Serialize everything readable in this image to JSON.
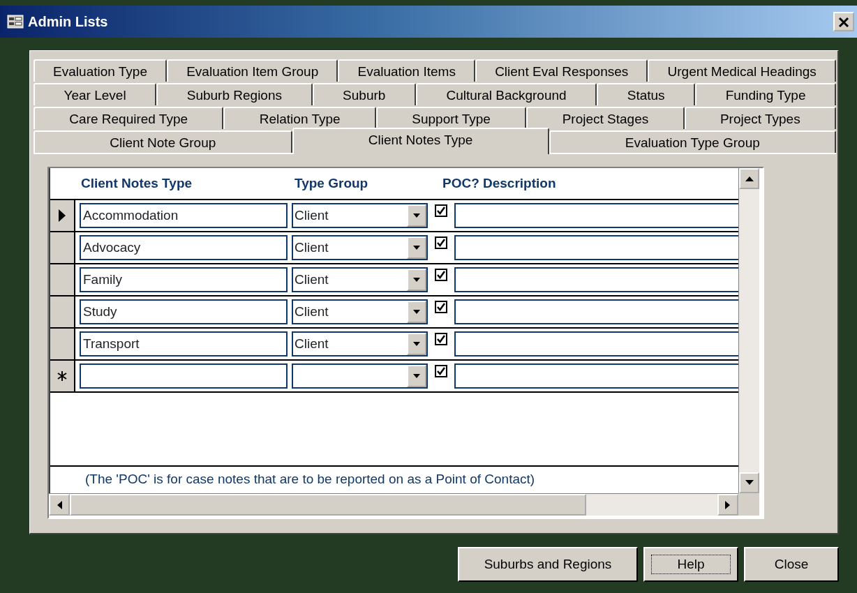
{
  "window": {
    "title": "Admin Lists"
  },
  "tab_rows": [
    [
      {
        "label": "Evaluation Type",
        "selected": false
      },
      {
        "label": "Evaluation Item Group",
        "selected": false
      },
      {
        "label": "Evaluation Items",
        "selected": false
      },
      {
        "label": "Client Eval Responses",
        "selected": false
      },
      {
        "label": "Urgent Medical Headings",
        "selected": false
      }
    ],
    [
      {
        "label": "Year Level",
        "selected": false
      },
      {
        "label": "Suburb Regions",
        "selected": false
      },
      {
        "label": "Suburb",
        "selected": false
      },
      {
        "label": "Cultural Background",
        "selected": false
      },
      {
        "label": "Status",
        "selected": false
      },
      {
        "label": "Funding Type",
        "selected": false
      }
    ],
    [
      {
        "label": "Care Required Type",
        "selected": false
      },
      {
        "label": "Relation Type",
        "selected": false
      },
      {
        "label": "Support Type",
        "selected": false
      },
      {
        "label": "Project Stages",
        "selected": false
      },
      {
        "label": "Project Types",
        "selected": false
      }
    ],
    [
      {
        "label": "Client Note Group",
        "selected": false
      },
      {
        "label": "Client Notes Type",
        "selected": true
      },
      {
        "label": "Evaluation Type Group",
        "selected": false
      }
    ]
  ],
  "grid": {
    "columns": [
      "Client Notes Type",
      "Type Group",
      "POC?",
      "Description"
    ],
    "rows": [
      {
        "kind": "record",
        "selected": true,
        "name": "Accommodation",
        "type_group": "Client",
        "poc": true
      },
      {
        "kind": "record",
        "selected": false,
        "name": "Advocacy",
        "type_group": "Client",
        "poc": true
      },
      {
        "kind": "record",
        "selected": false,
        "name": "Family",
        "type_group": "Client",
        "poc": true
      },
      {
        "kind": "record",
        "selected": false,
        "name": "Study",
        "type_group": "Client",
        "poc": true
      },
      {
        "kind": "record",
        "selected": false,
        "name": "Transport",
        "type_group": "Client",
        "poc": true
      },
      {
        "kind": "new",
        "selected": false,
        "poc": true
      }
    ],
    "note": "(The 'POC' is for case notes that are to be reported on as a Point of Contact)"
  },
  "buttons": [
    "Suburbs and Regions",
    "Help",
    "Close"
  ]
}
